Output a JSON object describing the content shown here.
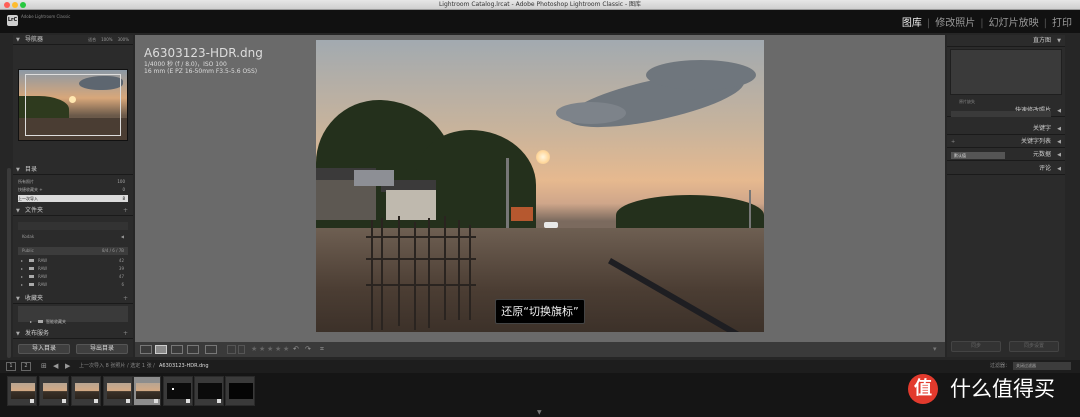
{
  "window": {
    "title": "Lightroom Catalog.lrcat - Adobe Photoshop Lightroom Classic - 图库"
  },
  "identity_plate": {
    "logo": "LrC",
    "line1": "Adobe Lightroom Classic",
    "line2": ""
  },
  "modules": [
    "图库",
    "修改照片",
    "幻灯片放映",
    "打印"
  ],
  "left_panel": {
    "navigator": {
      "title": "导航器",
      "fit": "适合",
      "p100": "100%",
      "p300": "300%"
    },
    "catalog": {
      "title": "目录",
      "items": [
        {
          "label": "所有照片",
          "count": "100"
        },
        {
          "label": "快捷收藏夹 +",
          "count": "0"
        },
        {
          "label": "上一次导入",
          "count": "8"
        }
      ]
    },
    "folders": {
      "title": "文件夹",
      "volume1": {
        "name": "Kodak",
        "count": ""
      },
      "volume2": {
        "name": "Public",
        "count": "8/4 / 6 / 7B"
      },
      "items": [
        {
          "name": "RAW",
          "count": "42"
        },
        {
          "name": "RAW",
          "count": "39"
        },
        {
          "name": "RAW",
          "count": "47"
        },
        {
          "name": "RAW",
          "count": "6"
        }
      ]
    },
    "collections": {
      "title": "收藏夹",
      "smart": "智能收藏夹"
    },
    "publish": {
      "title": "发布服务"
    },
    "import_button": "导入目录",
    "export_button": "导出目录"
  },
  "right_panel": {
    "histogram": {
      "title": "直方图",
      "label": "原片缺失"
    },
    "quick_develop": "快速修改照片",
    "keywords": "关键字",
    "keyword_list": "关键字列表",
    "metadata": "元数据",
    "metadata_preset": "默认值",
    "comments": "评论",
    "sync_button": "同步",
    "sync_settings_button": "同步设置"
  },
  "loupe": {
    "filename": "A6303123-HDR.dng",
    "exposure": "1/4000 秒 (f / 8.0)，ISO 100",
    "lens": "16 mm (E PZ 16-50mm F3.5-5.6 OSS)",
    "tooltip": "还原“切换旗标”"
  },
  "filmstrip_bar": {
    "page1": "1",
    "page2": "2",
    "source": "上一次导入  8 张照片 / 选定 1 张 /",
    "current_file": "A6303123-HDR.dng",
    "filter_label": "过滤器：",
    "filter_value": "关闭过滤器"
  },
  "filmstrip": [
    {
      "kind": "sun"
    },
    {
      "kind": "sun"
    },
    {
      "kind": "sun"
    },
    {
      "kind": "sun"
    },
    {
      "kind": "sun",
      "selected": true
    },
    {
      "kind": "dark",
      "dot": true
    },
    {
      "kind": "dark"
    }
  ],
  "watermark": {
    "icon": "值",
    "text": "什么值得买"
  },
  "colors": {
    "accent": "#e23a2d",
    "panel": "#2b2b2b",
    "background": "#6a6a6a"
  }
}
